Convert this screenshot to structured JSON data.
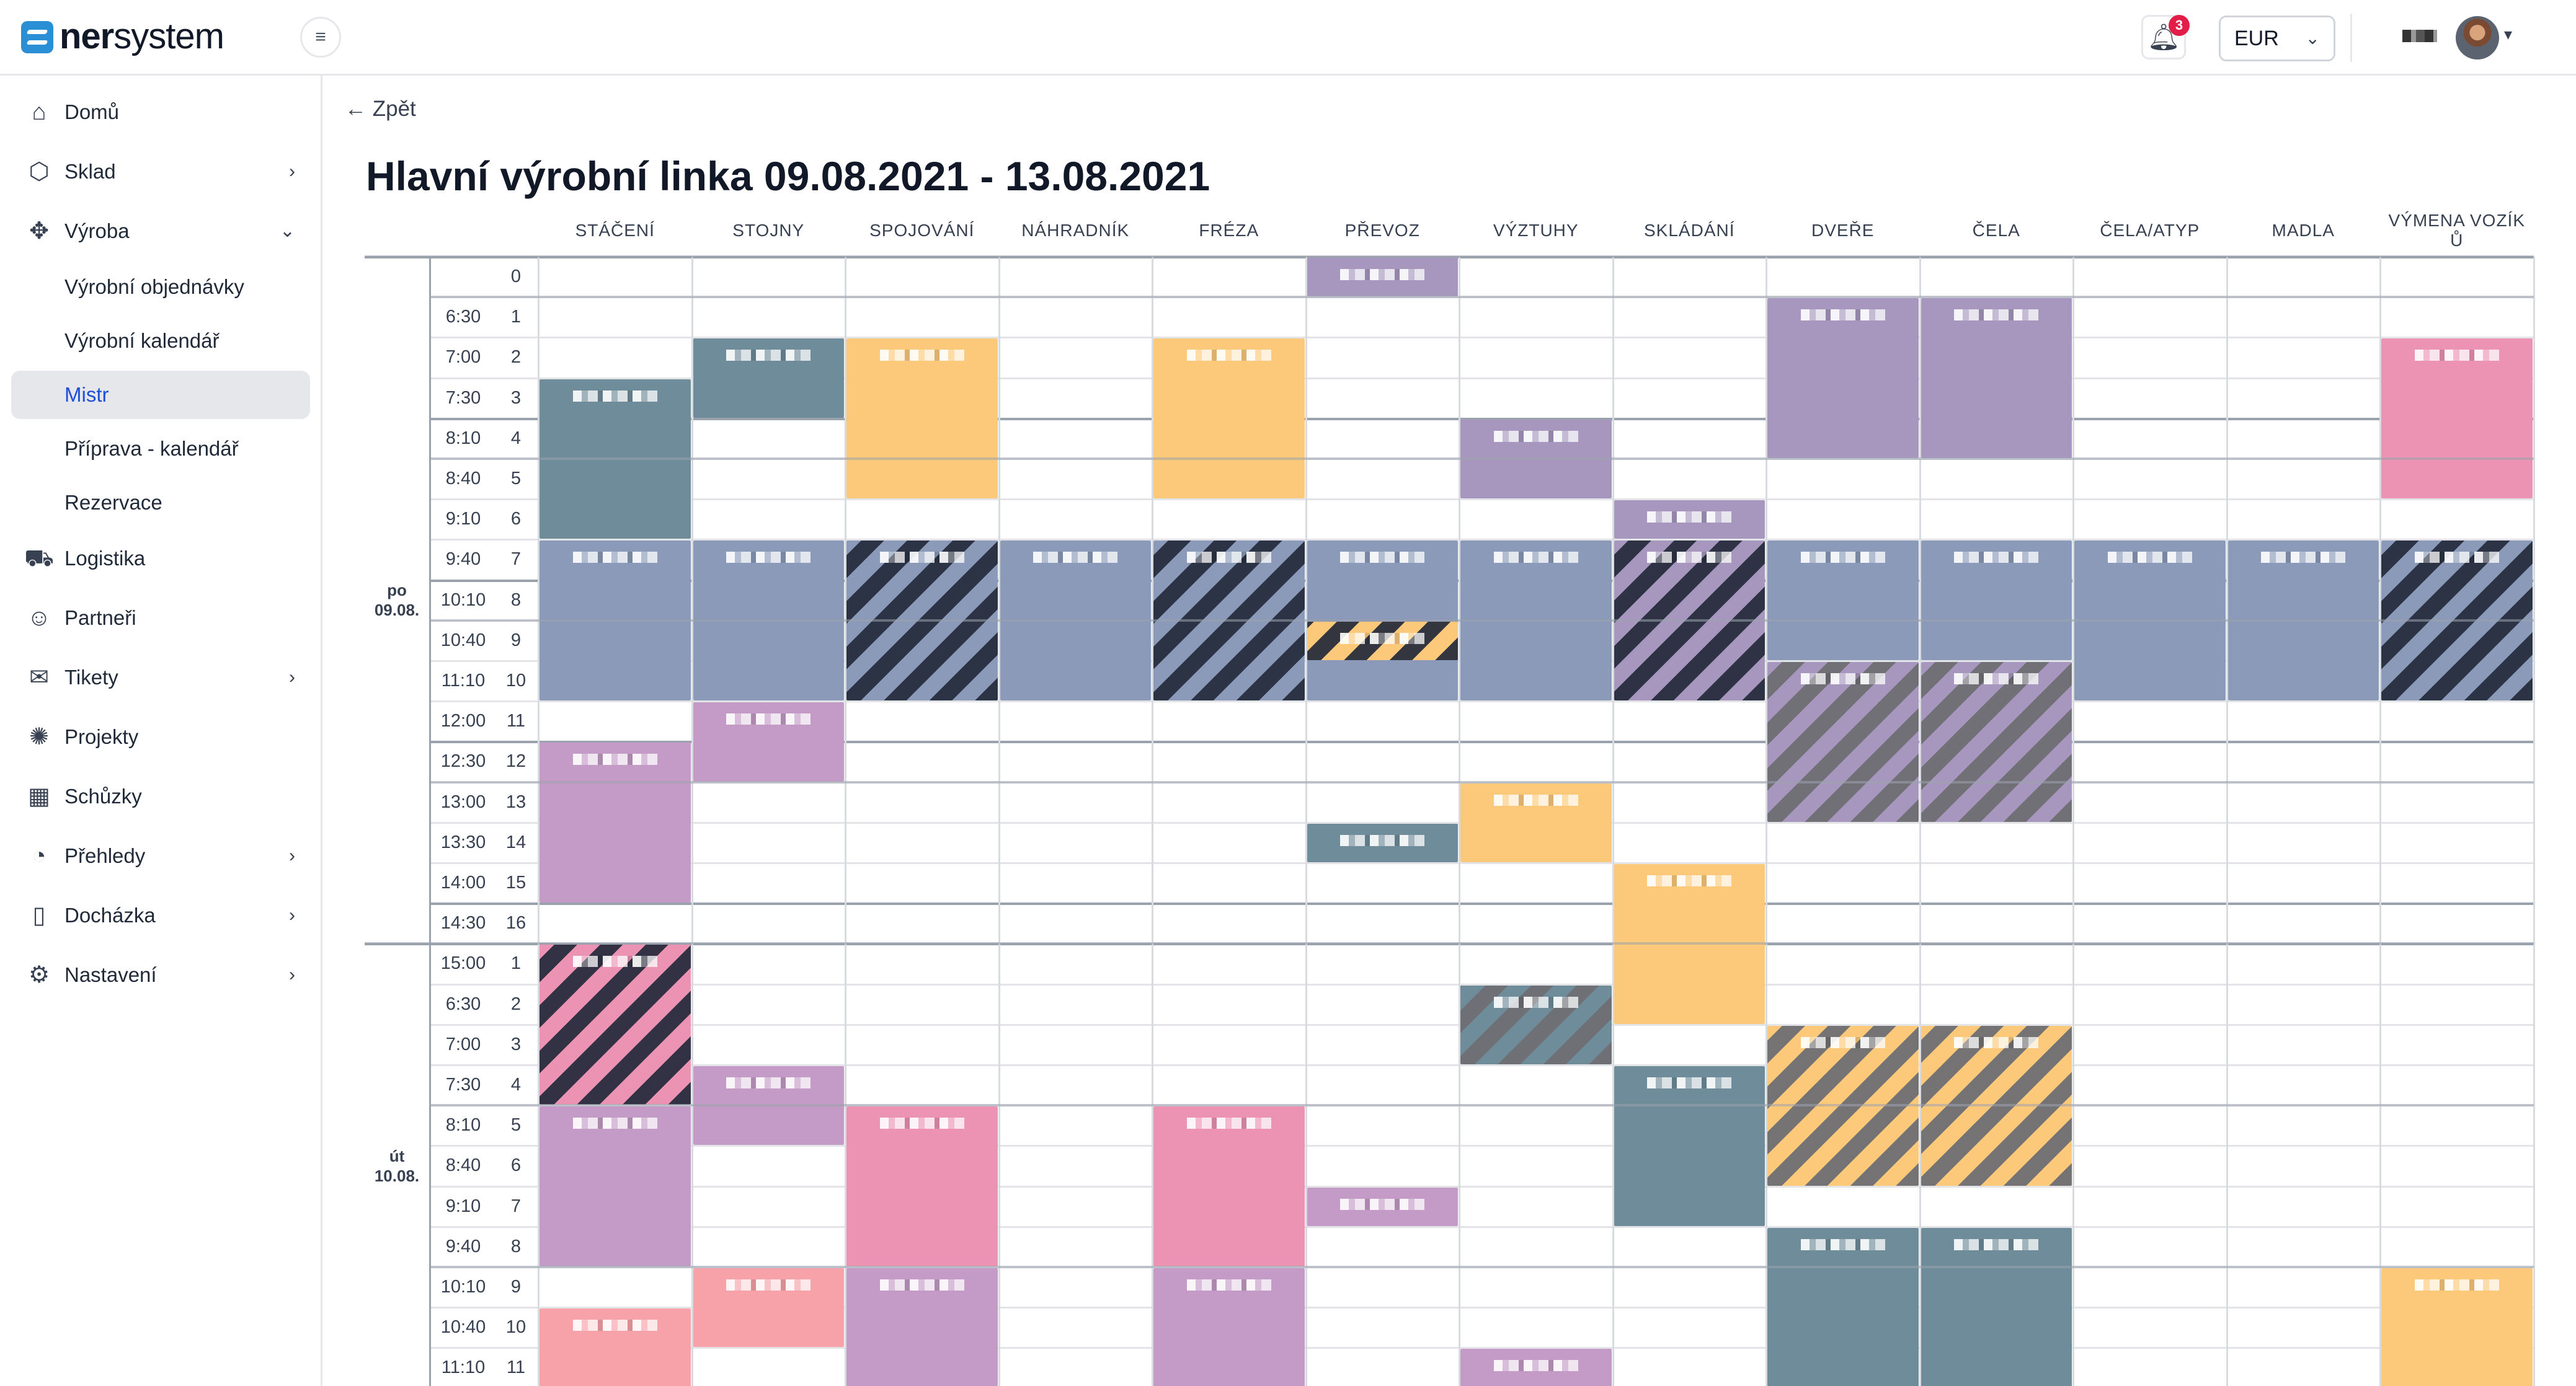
{
  "brand": {
    "name_bold": "ner",
    "name_rest": "system"
  },
  "topbar": {
    "notifications_count": "3",
    "currency": "EUR"
  },
  "sidebar": {
    "items": [
      {
        "label": "Domů",
        "icon": "home-icon",
        "glyph": "⌂"
      },
      {
        "label": "Sklad",
        "icon": "box-icon",
        "glyph": "⬡",
        "chevron": "›"
      },
      {
        "label": "Výroba",
        "icon": "puzzle-icon",
        "glyph": "✥",
        "chevron": "⌄"
      },
      {
        "label": "Výrobní objednávky",
        "sub": true
      },
      {
        "label": "Výrobní kalendář",
        "sub": true
      },
      {
        "label": "Mistr",
        "sub": true,
        "active": true
      },
      {
        "label": "Příprava - kalendář",
        "sub": true
      },
      {
        "label": "Rezervace",
        "sub": true
      },
      {
        "label": "Logistika",
        "icon": "truck-icon",
        "glyph": "⛟"
      },
      {
        "label": "Partneři",
        "icon": "users-icon",
        "glyph": "☺"
      },
      {
        "label": "Tikety",
        "icon": "chat-icon",
        "glyph": "✉",
        "chevron": "›"
      },
      {
        "label": "Projekty",
        "icon": "lightbulb-icon",
        "glyph": "✺"
      },
      {
        "label": "Schůzky",
        "icon": "calendar-icon",
        "glyph": "▦"
      },
      {
        "label": "Přehledy",
        "icon": "pie-chart-icon",
        "glyph": "◔",
        "chevron": "›"
      },
      {
        "label": "Docházka",
        "icon": "book-icon",
        "glyph": "▯",
        "chevron": "›"
      },
      {
        "label": "Nastavení",
        "icon": "gear-icon",
        "glyph": "⚙",
        "chevron": "›"
      }
    ]
  },
  "main": {
    "back_label": "← Zpět",
    "title": "Hlavní výrobní linka 09.08.2021 - 13.08.2021"
  },
  "schedule": {
    "columns": [
      "STÁČENÍ",
      "STOJNY",
      "SPOJOVÁNÍ",
      "NÁHRADNÍK",
      "FRÉZA",
      "PŘEVOZ",
      "VÝZTUHY",
      "SKLÁDÁNÍ",
      "DVEŘE",
      "ČELA",
      "ČELA/ATYP",
      "MADLA",
      "VÝMENA VOZÍK Ů"
    ],
    "days": [
      {
        "label": "po",
        "date": "09.08.",
        "slots": [
          [
            "",
            "0"
          ],
          [
            "6:30",
            "1"
          ],
          [
            "7:00",
            "2"
          ],
          [
            "7:30",
            "3"
          ],
          [
            "8:10",
            "4"
          ],
          [
            "8:40",
            "5"
          ],
          [
            "9:10",
            "6"
          ],
          [
            "9:40",
            "7"
          ],
          [
            "10:10",
            "8"
          ],
          [
            "10:40",
            "9"
          ],
          [
            "11:10",
            "10"
          ],
          [
            "12:00",
            "11"
          ],
          [
            "12:30",
            "12"
          ],
          [
            "13:00",
            "13"
          ],
          [
            "13:30",
            "14"
          ],
          [
            "14:00",
            "15"
          ],
          [
            "14:30",
            "16"
          ]
        ]
      },
      {
        "label": "út",
        "date": "10.08.",
        "slots": [
          [
            "15:00",
            "1"
          ],
          [
            "6:30",
            "2"
          ],
          [
            "7:00",
            "3"
          ],
          [
            "7:30",
            "4"
          ],
          [
            "8:10",
            "5"
          ],
          [
            "8:40",
            "6"
          ],
          [
            "9:10",
            "7"
          ],
          [
            "9:40",
            "8"
          ],
          [
            "10:10",
            "9"
          ],
          [
            "10:40",
            "10"
          ],
          [
            "11:10",
            "11"
          ]
        ]
      }
    ],
    "colors": {
      "teal": "#6f8c9b",
      "orange": "#fcc97a",
      "purple": "#a797bf",
      "pink": "#ec92b3",
      "slate": "#8a9ab8",
      "mauve": "#c49bc6",
      "salmon": "#f7a2a8",
      "dark": "#2a3342"
    },
    "blocks": [
      {
        "col": 5,
        "start": 0,
        "len": 1,
        "color": "purple"
      },
      {
        "col": 8,
        "start": 1,
        "len": 4,
        "color": "purple"
      },
      {
        "col": 9,
        "start": 1,
        "len": 4,
        "color": "purple"
      },
      {
        "col": 1,
        "start": 2,
        "len": 2,
        "color": "teal"
      },
      {
        "col": 2,
        "start": 2,
        "len": 4,
        "color": "orange"
      },
      {
        "col": 4,
        "start": 2,
        "len": 4,
        "color": "orange"
      },
      {
        "col": 12,
        "start": 2,
        "len": 4,
        "color": "pink"
      },
      {
        "col": 0,
        "start": 3,
        "len": 4,
        "color": "teal"
      },
      {
        "col": 6,
        "start": 4,
        "len": 2,
        "color": "purple"
      },
      {
        "col": 7,
        "start": 6,
        "len": 1,
        "color": "purple"
      },
      {
        "col": 0,
        "start": 7,
        "len": 4,
        "color": "slate"
      },
      {
        "col": 1,
        "start": 7,
        "len": 4,
        "color": "slate"
      },
      {
        "col": 2,
        "start": 7,
        "len": 4,
        "color": "slate",
        "stripe": "dark"
      },
      {
        "col": 3,
        "start": 7,
        "len": 4,
        "color": "slate"
      },
      {
        "col": 4,
        "start": 7,
        "len": 4,
        "color": "slate",
        "stripe": "dark"
      },
      {
        "col": 5,
        "start": 7,
        "len": 4,
        "color": "slate"
      },
      {
        "col": 5,
        "start": 9,
        "len": 1,
        "color": "orange",
        "stripe": "dark"
      },
      {
        "col": 6,
        "start": 7,
        "len": 4,
        "color": "slate"
      },
      {
        "col": 7,
        "start": 7,
        "len": 4,
        "color": "purple",
        "stripe": "dark"
      },
      {
        "col": 8,
        "start": 7,
        "len": 3,
        "color": "slate"
      },
      {
        "col": 9,
        "start": 7,
        "len": 3,
        "color": "slate"
      },
      {
        "col": 10,
        "start": 7,
        "len": 4,
        "color": "slate"
      },
      {
        "col": 11,
        "start": 7,
        "len": 4,
        "color": "slate"
      },
      {
        "col": 12,
        "start": 7,
        "len": 4,
        "color": "slate",
        "stripe": "dark"
      },
      {
        "col": 8,
        "start": 10,
        "len": 4,
        "color": "purple",
        "stripe": "grey"
      },
      {
        "col": 9,
        "start": 10,
        "len": 4,
        "color": "purple",
        "stripe": "grey"
      },
      {
        "col": 1,
        "start": 11,
        "len": 2,
        "color": "mauve"
      },
      {
        "col": 0,
        "start": 12,
        "len": 4,
        "color": "mauve"
      },
      {
        "col": 6,
        "start": 13,
        "len": 2,
        "color": "orange"
      },
      {
        "col": 5,
        "start": 14,
        "len": 1,
        "color": "teal"
      },
      {
        "col": 7,
        "start": 15,
        "len": 4,
        "color": "orange"
      },
      {
        "col": 0,
        "start": 17,
        "len": 4,
        "color": "pink",
        "stripe": "dark"
      },
      {
        "col": 6,
        "start": 18,
        "len": 2,
        "color": "teal",
        "stripe": "grey"
      },
      {
        "col": 8,
        "start": 19,
        "len": 4,
        "color": "orange",
        "stripe": "grey"
      },
      {
        "col": 9,
        "start": 19,
        "len": 4,
        "color": "orange",
        "stripe": "grey"
      },
      {
        "col": 1,
        "start": 20,
        "len": 2,
        "color": "mauve"
      },
      {
        "col": 7,
        "start": 20,
        "len": 4,
        "color": "teal"
      },
      {
        "col": 0,
        "start": 21,
        "len": 4,
        "color": "mauve"
      },
      {
        "col": 2,
        "start": 21,
        "len": 4,
        "color": "pink"
      },
      {
        "col": 4,
        "start": 21,
        "len": 4,
        "color": "pink"
      },
      {
        "col": 5,
        "start": 23,
        "len": 1,
        "color": "mauve"
      },
      {
        "col": 8,
        "start": 24,
        "len": 5,
        "color": "teal"
      },
      {
        "col": 9,
        "start": 24,
        "len": 5,
        "color": "teal"
      },
      {
        "col": 1,
        "start": 25,
        "len": 2,
        "color": "salmon"
      },
      {
        "col": 2,
        "start": 25,
        "len": 4,
        "color": "mauve"
      },
      {
        "col": 4,
        "start": 25,
        "len": 4,
        "color": "mauve"
      },
      {
        "col": 12,
        "start": 25,
        "len": 4,
        "color": "orange"
      },
      {
        "col": 0,
        "start": 26,
        "len": 3,
        "color": "salmon"
      },
      {
        "col": 6,
        "start": 27,
        "len": 2,
        "color": "mauve"
      }
    ]
  }
}
